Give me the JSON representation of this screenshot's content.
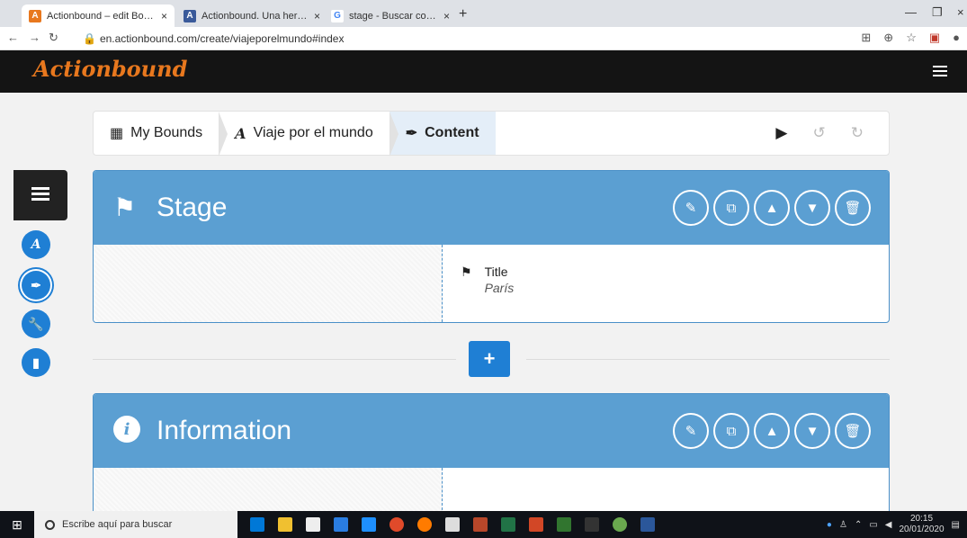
{
  "browser": {
    "tabs": [
      {
        "title": "Actionbound – edit Bound | Crea",
        "icon": "actionbound-favicon",
        "color": "#e8781e"
      },
      {
        "title": "Actionbound. Una herramienta m",
        "icon": "site-favicon",
        "color": "#3a5a9a"
      },
      {
        "title": "stage - Buscar con Google",
        "icon": "google-favicon",
        "color": "#4285f4"
      }
    ],
    "url": "en.actionbound.com/create/viajeporelmundo#index"
  },
  "app": {
    "logo": "Actionbound"
  },
  "breadcrumb": {
    "items": [
      {
        "label": "My Bounds",
        "icon": "grid-icon"
      },
      {
        "label": "Viaje por el mundo",
        "icon": "bound-icon"
      },
      {
        "label": "Content",
        "icon": "feather-icon"
      }
    ]
  },
  "cards": [
    {
      "title": "Stage",
      "icon": "flag-icon",
      "field_label": "Title",
      "field_value": "París"
    },
    {
      "title": "Information",
      "icon": "info-icon"
    }
  ],
  "taskbar": {
    "search_placeholder": "Escribe aquí para buscar",
    "time": "20:15",
    "date": "20/01/2020"
  }
}
